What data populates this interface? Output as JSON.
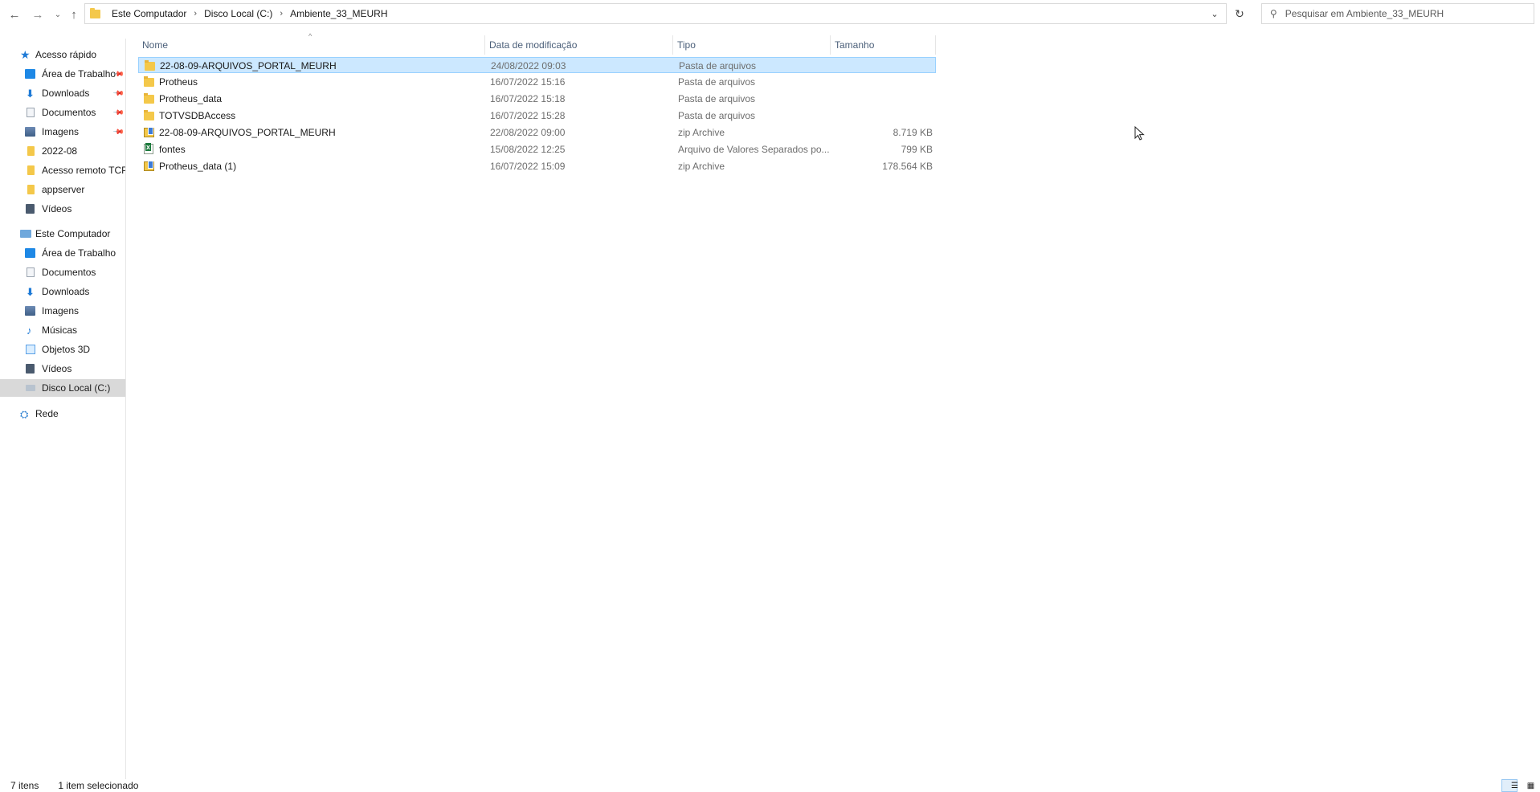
{
  "window": {
    "breadcrumb": [
      "Este Computador",
      "Disco Local (C:)",
      "Ambiente_33_MEURH"
    ],
    "search_placeholder": "Pesquisar em Ambiente_33_MEURH"
  },
  "icons": {
    "back": "arrow-left-icon",
    "forward": "arrow-right-icon",
    "recent": "chevron-down-icon",
    "up": "arrow-up-icon",
    "refresh": "refresh-icon",
    "search": "search-icon"
  },
  "sidebar": {
    "quick_access": {
      "label": "Acesso rápido",
      "items": [
        {
          "label": "Área de Trabalho",
          "icon": "desktop-icon",
          "pinned": true
        },
        {
          "label": "Downloads",
          "icon": "download-icon",
          "pinned": true
        },
        {
          "label": "Documentos",
          "icon": "document-icon",
          "pinned": true
        },
        {
          "label": "Imagens",
          "icon": "pictures-icon",
          "pinned": true
        },
        {
          "label": "2022-08",
          "icon": "folder-icon",
          "pinned": false
        },
        {
          "label": "Acesso remoto TCP",
          "icon": "folder-icon",
          "pinned": false
        },
        {
          "label": "appserver",
          "icon": "folder-icon",
          "pinned": false
        },
        {
          "label": "Vídeos",
          "icon": "videos-icon",
          "pinned": false
        }
      ]
    },
    "this_pc": {
      "label": "Este Computador",
      "items": [
        {
          "label": "Área de Trabalho",
          "icon": "desktop-icon"
        },
        {
          "label": "Documentos",
          "icon": "document-icon"
        },
        {
          "label": "Downloads",
          "icon": "download-icon"
        },
        {
          "label": "Imagens",
          "icon": "pictures-icon"
        },
        {
          "label": "Músicas",
          "icon": "music-icon"
        },
        {
          "label": "Objetos 3D",
          "icon": "3d-objects-icon"
        },
        {
          "label": "Vídeos",
          "icon": "videos-icon"
        },
        {
          "label": "Disco Local (C:)",
          "icon": "drive-icon",
          "selected": true
        }
      ]
    },
    "network": {
      "label": "Rede",
      "icon": "network-icon"
    }
  },
  "filelist": {
    "columns": {
      "name": "Nome",
      "date": "Data de modificação",
      "type": "Tipo",
      "size": "Tamanho"
    },
    "sorted_by": "name",
    "rows": [
      {
        "name": "22-08-09-ARQUIVOS_PORTAL_MEURH",
        "date": "24/08/2022 09:03",
        "type": "Pasta de arquivos",
        "size": "",
        "icon": "folder-icon",
        "selected": true
      },
      {
        "name": "Protheus",
        "date": "16/07/2022 15:16",
        "type": "Pasta de arquivos",
        "size": "",
        "icon": "folder-icon"
      },
      {
        "name": "Protheus_data",
        "date": "16/07/2022 15:18",
        "type": "Pasta de arquivos",
        "size": "",
        "icon": "folder-icon"
      },
      {
        "name": "TOTVSDBAccess",
        "date": "16/07/2022 15:28",
        "type": "Pasta de arquivos",
        "size": "",
        "icon": "folder-icon"
      },
      {
        "name": "22-08-09-ARQUIVOS_PORTAL_MEURH",
        "date": "22/08/2022 09:00",
        "type": "zip Archive",
        "size": "8.719 KB",
        "icon": "zip-icon"
      },
      {
        "name": "fontes",
        "date": "15/08/2022 12:25",
        "type": "Arquivo de Valores Separados po...",
        "size": "799 KB",
        "icon": "csv-icon"
      },
      {
        "name": "Protheus_data (1)",
        "date": "16/07/2022 15:09",
        "type": "zip Archive",
        "size": "178.564 KB",
        "icon": "zip-icon"
      }
    ]
  },
  "status": {
    "count": "7 itens",
    "selection": "1 item selecionado"
  },
  "colors": {
    "selection_bg": "#cce8ff",
    "selection_border": "#99d1ff",
    "header_text": "#4c607a",
    "folder": "#f4c84a"
  }
}
